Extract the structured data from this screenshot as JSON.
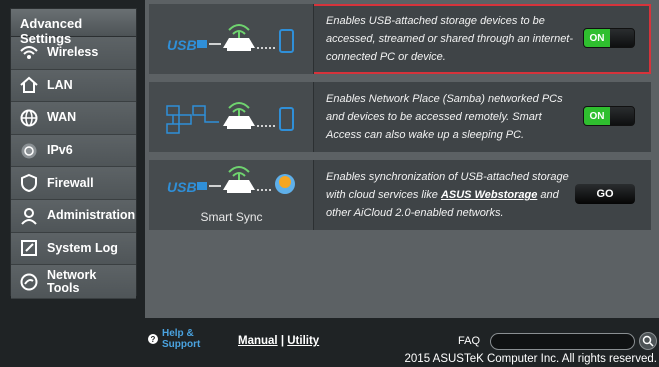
{
  "sidebar": {
    "header": "Advanced Settings",
    "items": [
      {
        "label": "Wireless",
        "icon": "wifi-icon"
      },
      {
        "label": "LAN",
        "icon": "home-icon"
      },
      {
        "label": "WAN",
        "icon": "globe-icon"
      },
      {
        "label": "IPv6",
        "icon": "ipv6-icon"
      },
      {
        "label": "Firewall",
        "icon": "shield-icon"
      },
      {
        "label": "Administration",
        "icon": "user-icon"
      },
      {
        "label": "System Log",
        "icon": "log-icon"
      },
      {
        "label": "Network Tools",
        "icon": "tools-icon"
      }
    ]
  },
  "cards": [
    {
      "description": "Enables USB-attached storage devices to be accessed, streamed or shared through an internet-connected PC or device.",
      "toggle": "ON",
      "highlighted": true
    },
    {
      "description": "Enables Network Place (Samba) networked PCs and devices to be accessed remotely. Smart Access can also wake up a sleeping PC.",
      "toggle": "ON",
      "highlighted": false
    },
    {
      "description_before": "Enables synchronization of USB-attached storage with cloud services like ",
      "description_link": "ASUS Webstorage",
      "description_after": " and other AiCloud 2.0-enabled networks.",
      "graphic_label": "Smart Sync",
      "button": "GO"
    }
  ],
  "footer": {
    "help_line1": "Help &",
    "help_line2": "Support",
    "manual": "Manual",
    "separator": " | ",
    "utility": "Utility",
    "faq": "FAQ",
    "copyright": "2015 ASUSTeK Computer Inc. All rights reserved."
  },
  "colors": {
    "toggle_on": "#2fbf2f",
    "highlight_border": "#d6333b",
    "usb_blue": "#2f8fd8",
    "router_green": "#6fd36f"
  }
}
